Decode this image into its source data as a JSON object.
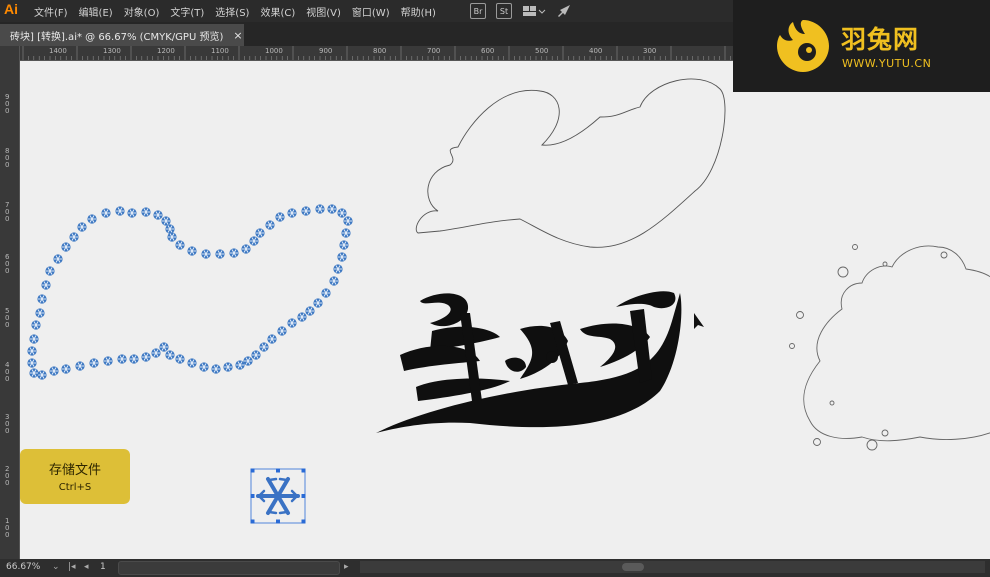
{
  "app": {
    "logo": "Ai"
  },
  "menu": {
    "items": [
      "文件(F)",
      "编辑(E)",
      "对象(O)",
      "文字(T)",
      "选择(S)",
      "效果(C)",
      "视图(V)",
      "窗口(W)",
      "帮助(H)"
    ]
  },
  "toolbar": {
    "br_label": "Br",
    "st_label": "St"
  },
  "tab": {
    "title": "砖块] [转换].ai* @ 66.67% (CMYK/GPU 预览)",
    "close": "×"
  },
  "ruler": {
    "h_labels": [
      "1400",
      "1300",
      "1200",
      "1100",
      "1000",
      "900",
      "800",
      "700",
      "600",
      "500",
      "400",
      "300"
    ],
    "v_labels": [
      "900",
      "800",
      "700",
      "600",
      "500",
      "400",
      "300",
      "200",
      "100"
    ]
  },
  "canvas": {
    "save_hint": {
      "title": "存储文件",
      "shortcut": "Ctrl+S"
    },
    "accent_colors": {
      "snowflake": "#3d78c2",
      "save_hint_bg": "#ddbf37",
      "brand": "#f0c020"
    }
  },
  "brand": {
    "name": "羽兔网",
    "url": "WWW.YUTU.CN"
  },
  "status": {
    "zoom": "66.67%",
    "page": "1"
  }
}
